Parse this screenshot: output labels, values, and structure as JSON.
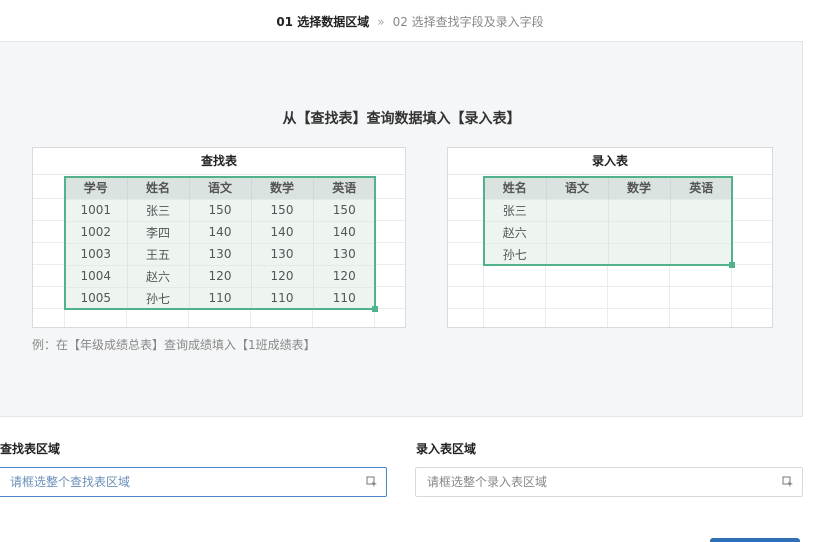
{
  "steps": {
    "active": "01 选择数据区域",
    "separator": "»",
    "next": "02 选择查找字段及录入字段"
  },
  "preview": {
    "title": "从【查找表】查询数据填入【录入表】",
    "lookup_table": {
      "title": "查找表",
      "headers": [
        "学号",
        "姓名",
        "语文",
        "数学",
        "英语"
      ],
      "rows": [
        [
          "1001",
          "张三",
          "150",
          "150",
          "150"
        ],
        [
          "1002",
          "李四",
          "140",
          "140",
          "140"
        ],
        [
          "1003",
          "王五",
          "130",
          "130",
          "130"
        ],
        [
          "1004",
          "赵六",
          "120",
          "120",
          "120"
        ],
        [
          "1005",
          "孙七",
          "110",
          "110",
          "110"
        ]
      ]
    },
    "entry_table": {
      "title": "录入表",
      "headers": [
        "姓名",
        "语文",
        "数学",
        "英语"
      ],
      "rows": [
        [
          "张三",
          "",
          "",
          ""
        ],
        [
          "赵六",
          "",
          "",
          ""
        ],
        [
          "孙七",
          "",
          "",
          ""
        ]
      ]
    },
    "example": "例：在【年级成绩总表】查询成绩填入【1班成绩表】"
  },
  "form": {
    "lookup_label": "查找表区域",
    "lookup_placeholder": "请框选整个查找表区域",
    "entry_label": "录入表区域",
    "entry_placeholder": "请框选整个录入表区域",
    "picker_icon": "range-select-icon",
    "accent_color": "#52b28b",
    "focus_color": "#4a86c5"
  }
}
